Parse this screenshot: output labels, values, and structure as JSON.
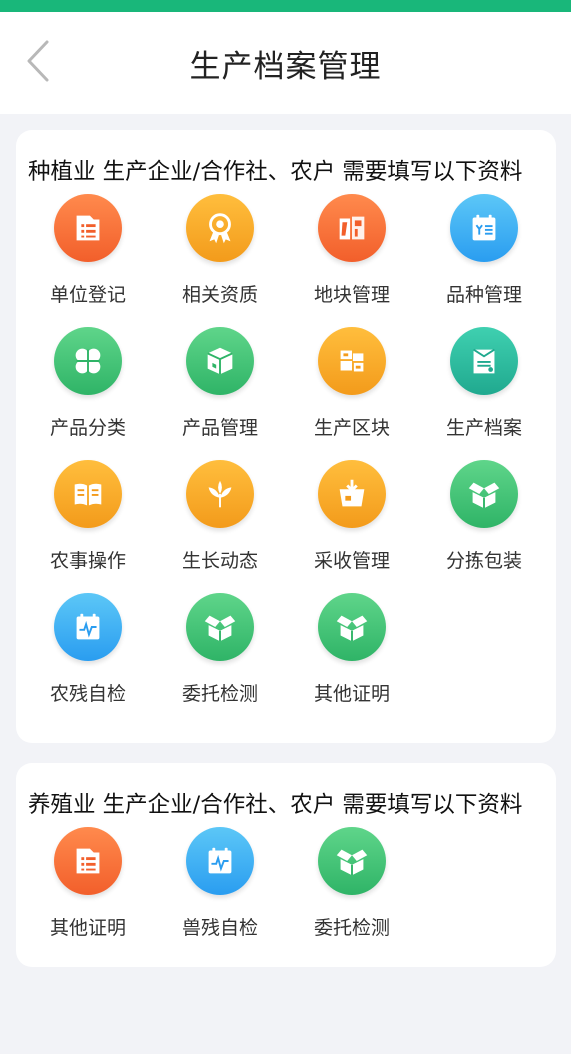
{
  "header": {
    "title": "生产档案管理",
    "back_icon": "chevron-left-icon"
  },
  "colors": {
    "status_strip": "#19b77a",
    "orange": "#f25f2b",
    "gold": "#f39b1b",
    "blue": "#2a9df0",
    "green": "#2fb467",
    "teal": "#20a98f"
  },
  "planting": {
    "title": "种植业 生产企业/合作社、农户 需要填写以下资料",
    "items": [
      {
        "label": "单位登记",
        "icon": "document-list-icon"
      },
      {
        "label": "相关资质",
        "icon": "award-ribbon-icon"
      },
      {
        "label": "地块管理",
        "icon": "land-plot-icon"
      },
      {
        "label": "品种管理",
        "icon": "variety-clipboard-icon"
      },
      {
        "label": "产品分类",
        "icon": "four-leaf-icon"
      },
      {
        "label": "产品管理",
        "icon": "product-box-icon"
      },
      {
        "label": "生产区块",
        "icon": "blocks-icon"
      },
      {
        "label": "生产档案",
        "icon": "archive-folder-icon"
      },
      {
        "label": "农事操作",
        "icon": "open-book-icon"
      },
      {
        "label": "生长动态",
        "icon": "sprout-icon"
      },
      {
        "label": "采收管理",
        "icon": "harvest-basket-icon"
      },
      {
        "label": "分拣包装",
        "icon": "open-box-icon"
      },
      {
        "label": "农残自检",
        "icon": "pulse-report-icon"
      },
      {
        "label": "委托检测",
        "icon": "open-box-icon"
      },
      {
        "label": "其他证明",
        "icon": "open-box-icon"
      }
    ]
  },
  "breeding": {
    "title": "养殖业 生产企业/合作社、农户 需要填写以下资料",
    "items": [
      {
        "label": "其他证明",
        "icon": "document-list-icon"
      },
      {
        "label": "兽残自检",
        "icon": "pulse-report-icon"
      },
      {
        "label": "委托检测",
        "icon": "open-box-icon"
      }
    ]
  }
}
